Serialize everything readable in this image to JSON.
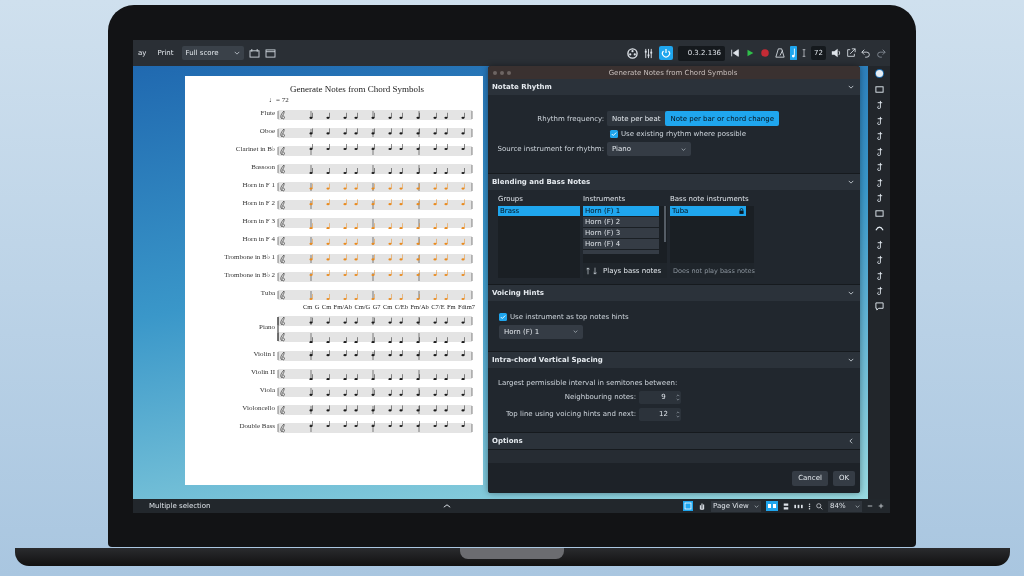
{
  "toolbar": {
    "left_buttons": [
      "ay",
      "Print"
    ],
    "score_select": "Full score",
    "timecode": "0.3.2.136",
    "tempo": "72",
    "power_on": true,
    "note_input_on": true
  },
  "score": {
    "title": "Generate Notes from Chord Symbols",
    "tempo_mark": "♩= 72",
    "staves": [
      {
        "name": "Flute",
        "kind": "single",
        "generated": false
      },
      {
        "name": "Oboe",
        "kind": "single",
        "generated": false
      },
      {
        "name": "Clarinet in B♭",
        "kind": "single",
        "generated": false
      },
      {
        "name": "Bassoon",
        "kind": "single",
        "generated": false
      },
      {
        "name": "Horn in F 1",
        "kind": "single",
        "generated": true
      },
      {
        "name": "Horn in F 2",
        "kind": "single",
        "generated": true
      },
      {
        "name": "Horn in F 3",
        "kind": "single",
        "generated": true
      },
      {
        "name": "Horn in F 4",
        "kind": "single",
        "generated": true
      },
      {
        "name": "Trombone in B♭ 1",
        "kind": "single",
        "generated": true
      },
      {
        "name": "Trombone in B♭ 2",
        "kind": "single",
        "generated": true
      },
      {
        "name": "Tuba",
        "kind": "single",
        "generated": true
      },
      {
        "name": "Piano",
        "kind": "grand",
        "generated": false
      },
      {
        "name": "Violin I",
        "kind": "single",
        "generated": false
      },
      {
        "name": "Violin II",
        "kind": "single",
        "generated": false
      },
      {
        "name": "Viola",
        "kind": "single",
        "generated": false
      },
      {
        "name": "Violoncello",
        "kind": "single",
        "generated": false
      },
      {
        "name": "Double Bass",
        "kind": "single",
        "generated": false
      }
    ],
    "chord_symbols": [
      "Cm",
      "G",
      "Cm",
      "Fm/Ab",
      "Cm/G",
      "G7",
      "Cm",
      "C/Eb",
      "Fm/Ab",
      "C7/E",
      "Fm",
      "Fdim7"
    ]
  },
  "dialog": {
    "title": "Generate Notes from Chord Symbols",
    "sections": [
      {
        "kind": "rhythm",
        "title": "Notate Rhythm",
        "expanded": true,
        "frequency_label": "Rhythm frequency:",
        "frequency_options": [
          {
            "label": "Note per beat",
            "selected": false
          },
          {
            "label": "Note per bar or chord change",
            "selected": true
          }
        ],
        "checkbox": {
          "label": "Use existing rhythm where possible",
          "checked": true
        },
        "source_label": "Source instrument for rhythm:",
        "source_value": "Piano"
      },
      {
        "kind": "blending",
        "title": "Blending and Bass Notes",
        "expanded": true,
        "groups_heading": "Groups",
        "groups": [
          {
            "label": "Brass",
            "selected": true
          }
        ],
        "instruments_heading": "Instruments",
        "instruments": [
          {
            "label": "Horn (F) 1",
            "selected": true
          },
          {
            "label": "Horn (F) 2",
            "selected": false
          },
          {
            "label": "Horn (F) 3",
            "selected": false
          },
          {
            "label": "Horn (F) 4",
            "selected": false
          }
        ],
        "plays_bass": "Plays bass notes",
        "bass_heading": "Bass note instruments",
        "bass_instruments": [
          {
            "label": "Tuba",
            "selected": true
          }
        ],
        "no_bass": "Does not play bass notes"
      },
      {
        "kind": "voicing",
        "title": "Voicing Hints",
        "expanded": true,
        "checkbox": {
          "label": "Use instrument as top notes hints",
          "checked": true
        },
        "select_value": "Horn (F) 1"
      },
      {
        "kind": "spacing",
        "title": "Intra-chord Vertical Spacing",
        "expanded": true,
        "intro": "Largest permissible interval in semitones between:",
        "fields": [
          {
            "label": "Neighbouring notes:",
            "value": "9"
          },
          {
            "label": "Top line using voicing hints and next:",
            "value": "12"
          }
        ]
      },
      {
        "kind": "options",
        "title": "Options",
        "expanded": false
      }
    ],
    "buttons": [
      "Cancel",
      "OK"
    ]
  },
  "status_bar": {
    "selection": "Multiple selection",
    "view_mode": "Page View",
    "zoom": "84%"
  }
}
